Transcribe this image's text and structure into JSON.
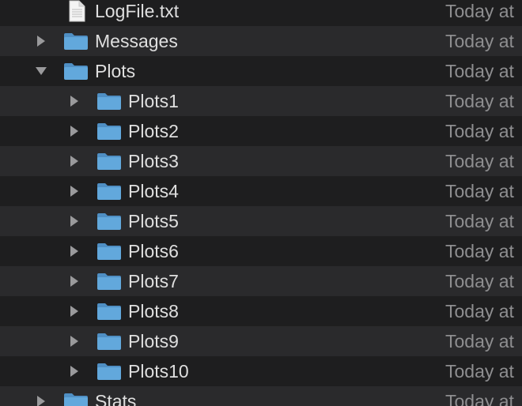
{
  "colors": {
    "folder": "#62a8dc",
    "folder_tab": "#4f8fc4",
    "text": "#dfdfdf",
    "date_text": "#8e8e90",
    "row_even": "#1e1e1f",
    "row_odd": "#2a2a2c"
  },
  "rows": [
    {
      "name": "LogFile.txt",
      "kind": "document-icon",
      "level": 0,
      "disclosure": "none",
      "date": "Today at"
    },
    {
      "name": "Messages",
      "kind": "folder-icon",
      "level": 0,
      "disclosure": "collapsed",
      "date": "Today at"
    },
    {
      "name": "Plots",
      "kind": "folder-icon",
      "level": 0,
      "disclosure": "expanded",
      "date": "Today at"
    },
    {
      "name": "Plots1",
      "kind": "folder-icon",
      "level": 1,
      "disclosure": "collapsed",
      "date": "Today at"
    },
    {
      "name": "Plots2",
      "kind": "folder-icon",
      "level": 1,
      "disclosure": "collapsed",
      "date": "Today at"
    },
    {
      "name": "Plots3",
      "kind": "folder-icon",
      "level": 1,
      "disclosure": "collapsed",
      "date": "Today at"
    },
    {
      "name": "Plots4",
      "kind": "folder-icon",
      "level": 1,
      "disclosure": "collapsed",
      "date": "Today at"
    },
    {
      "name": "Plots5",
      "kind": "folder-icon",
      "level": 1,
      "disclosure": "collapsed",
      "date": "Today at"
    },
    {
      "name": "Plots6",
      "kind": "folder-icon",
      "level": 1,
      "disclosure": "collapsed",
      "date": "Today at"
    },
    {
      "name": "Plots7",
      "kind": "folder-icon",
      "level": 1,
      "disclosure": "collapsed",
      "date": "Today at"
    },
    {
      "name": "Plots8",
      "kind": "folder-icon",
      "level": 1,
      "disclosure": "collapsed",
      "date": "Today at"
    },
    {
      "name": "Plots9",
      "kind": "folder-icon",
      "level": 1,
      "disclosure": "collapsed",
      "date": "Today at"
    },
    {
      "name": "Plots10",
      "kind": "folder-icon",
      "level": 1,
      "disclosure": "collapsed",
      "date": "Today at"
    },
    {
      "name": "Stats",
      "kind": "folder-icon",
      "level": 0,
      "disclosure": "collapsed",
      "date": "Today at"
    }
  ]
}
